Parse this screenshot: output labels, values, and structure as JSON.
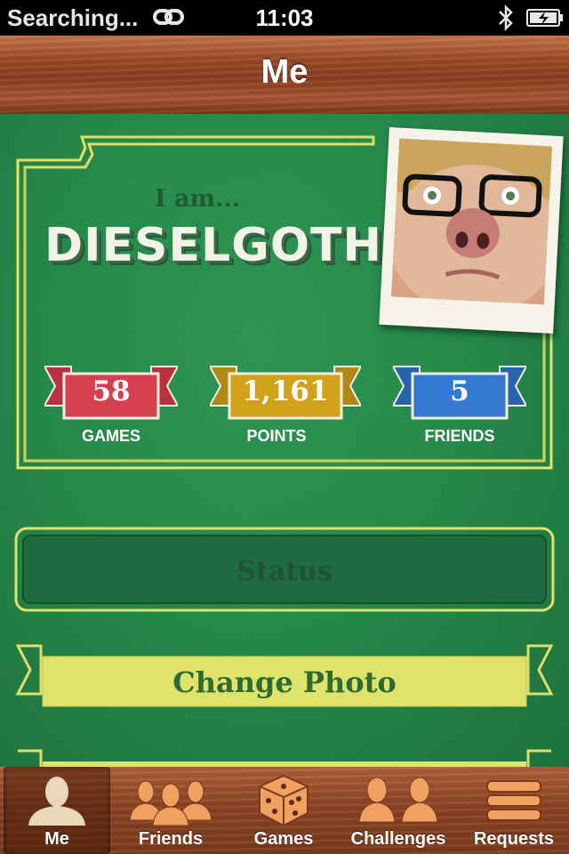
{
  "status_bar": {
    "carrier": "Searching...",
    "time": "11:03"
  },
  "nav": {
    "title": "Me"
  },
  "profile": {
    "intro": "I am...",
    "username": "DIESELGOTH",
    "stats": [
      {
        "value": "58",
        "label": "GAMES",
        "color": "#d5414f"
      },
      {
        "value": "1,161",
        "label": "POINTS",
        "color": "#d2a11c"
      },
      {
        "value": "5",
        "label": "FRIENDS",
        "color": "#3578cf"
      }
    ]
  },
  "status_button": {
    "label": "Status"
  },
  "change_photo_button": {
    "label": "Change Photo"
  },
  "tabs": [
    {
      "label": "Me",
      "icon": "person-icon",
      "selected": true
    },
    {
      "label": "Friends",
      "icon": "people-icon",
      "selected": false
    },
    {
      "label": "Games",
      "icon": "dice-icon",
      "selected": false
    },
    {
      "label": "Challenges",
      "icon": "challenges-icon",
      "selected": false
    },
    {
      "label": "Requests",
      "icon": "requests-icon",
      "selected": false
    }
  ],
  "colors": {
    "felt": "#268a4a",
    "gold_trim": "#e3e36a",
    "wood": "#8c4424"
  }
}
